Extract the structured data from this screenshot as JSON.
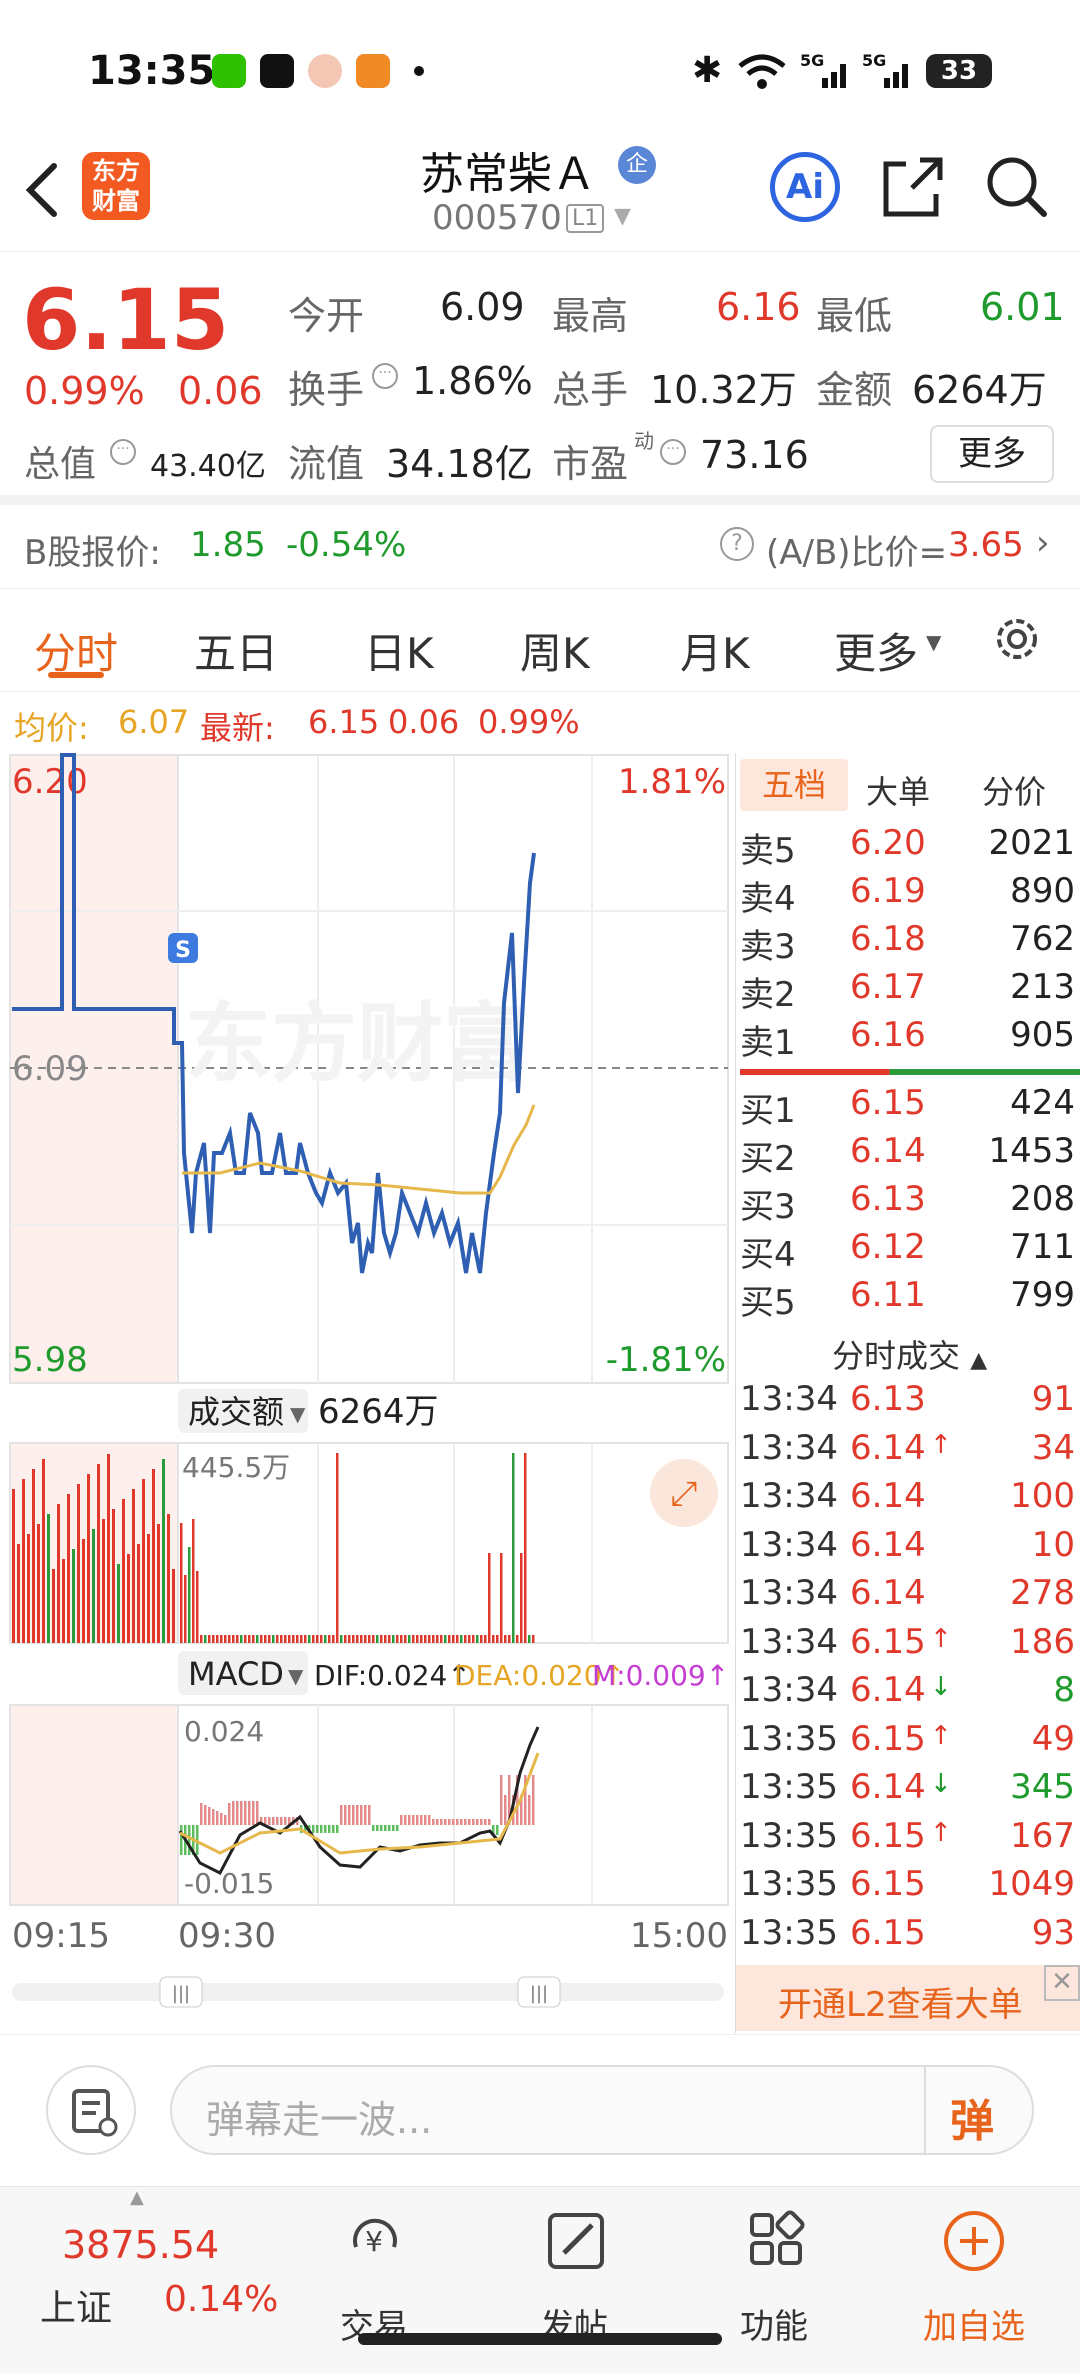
{
  "status_bar": {
    "time": "13:35",
    "battery": "33"
  },
  "header": {
    "stock_name": "苏常柴Ａ",
    "badge": "企",
    "stock_code": "000570",
    "level": "L1",
    "logo_text_line1": "东方",
    "logo_text_line2": "财富",
    "ai_label": "Ai"
  },
  "quote": {
    "price": "6.15",
    "change_pct": "0.99%",
    "change": "0.06",
    "open_label": "今开",
    "open": "6.09",
    "high_label": "最高",
    "high": "6.16",
    "low_label": "最低",
    "low": "6.01",
    "turnover_label": "换手",
    "turnover": "1.86%",
    "volume_label": "总手",
    "volume": "10.32万",
    "amount_label": "金额",
    "amount": "6264万",
    "mcap_label": "总值",
    "mcap": "43.40亿",
    "float_label": "流值",
    "float": "34.18亿",
    "pe_label": "市盈",
    "pe_sup": "动",
    "pe": "73.16",
    "more": "更多"
  },
  "b_share": {
    "label": "B股报价:",
    "price": "1.85",
    "change": "-0.54%",
    "ratio_label": "(A/B)比价=",
    "ratio": "3.65"
  },
  "tabs": [
    "分时",
    "五日",
    "日K",
    "周K",
    "月K",
    "更多"
  ],
  "avg_line": {
    "avg_label": "均价:",
    "avg": "6.07",
    "latest_label": "最新:",
    "latest": "6.15",
    "chg": "0.06",
    "pct": "0.99%"
  },
  "chart": {
    "y_high": "6.20",
    "y_mid": "6.09",
    "y_low": "5.98",
    "pct_high": "1.81%",
    "pct_low": "-1.81%",
    "watermark": "东方财富",
    "marker": "S",
    "vol_selector": "成交额",
    "vol_total": "6264万",
    "vol_max": "445.5万",
    "macd_selector": "MACD",
    "dif": "DIF:0.024↑",
    "dea": "DEA:0.020↑",
    "m": "M:0.009↑",
    "macd_high": "0.024",
    "macd_low": "-0.015",
    "time_start": "09:15",
    "time_open": "09:30",
    "time_end": "15:00",
    "price_series": [
      6.09,
      6.09,
      6.2,
      6.2,
      6.09,
      6.09,
      6.09,
      6.09,
      6.09,
      6.06,
      6.04,
      6.05,
      6.06,
      6.05,
      6.07,
      6.05,
      6.06,
      6.05,
      6.04,
      6.05,
      6.04,
      6.03,
      6.04,
      6.05,
      6.04,
      6.03,
      6.02,
      6.03,
      6.04,
      6.03,
      6.04,
      6.03,
      6.04,
      6.03,
      6.02,
      6.03,
      6.05,
      6.08,
      6.1,
      6.12,
      6.11,
      6.14,
      6.16
    ]
  },
  "order_book": {
    "tabs": [
      "五档",
      "大单",
      "分价"
    ],
    "asks": [
      {
        "label": "卖5",
        "price": "6.20",
        "vol": "2021"
      },
      {
        "label": "卖4",
        "price": "6.19",
        "vol": "890"
      },
      {
        "label": "卖3",
        "price": "6.18",
        "vol": "762"
      },
      {
        "label": "卖2",
        "price": "6.17",
        "vol": "213"
      },
      {
        "label": "卖1",
        "price": "6.16",
        "vol": "905"
      }
    ],
    "bids": [
      {
        "label": "买1",
        "price": "6.15",
        "vol": "424"
      },
      {
        "label": "买2",
        "price": "6.14",
        "vol": "1453"
      },
      {
        "label": "买3",
        "price": "6.13",
        "vol": "208"
      },
      {
        "label": "买4",
        "price": "6.12",
        "vol": "711"
      },
      {
        "label": "买5",
        "price": "6.11",
        "vol": "799"
      }
    ],
    "trades_title": "分时成交",
    "trades": [
      {
        "time": "13:34",
        "price": "6.13",
        "arrow": "",
        "vol": "91",
        "dir": "buy"
      },
      {
        "time": "13:34",
        "price": "6.14",
        "arrow": "↑",
        "vol": "34",
        "dir": "buy"
      },
      {
        "time": "13:34",
        "price": "6.14",
        "arrow": "",
        "vol": "100",
        "dir": "buy"
      },
      {
        "time": "13:34",
        "price": "6.14",
        "arrow": "",
        "vol": "10",
        "dir": "buy"
      },
      {
        "time": "13:34",
        "price": "6.14",
        "arrow": "",
        "vol": "278",
        "dir": "buy"
      },
      {
        "time": "13:34",
        "price": "6.15",
        "arrow": "↑",
        "vol": "186",
        "dir": "buy"
      },
      {
        "time": "13:34",
        "price": "6.14",
        "arrow": "↓",
        "vol": "8",
        "dir": "sell"
      },
      {
        "time": "13:35",
        "price": "6.15",
        "arrow": "↑",
        "vol": "49",
        "dir": "buy"
      },
      {
        "time": "13:35",
        "price": "6.14",
        "arrow": "↓",
        "vol": "345",
        "dir": "sell"
      },
      {
        "time": "13:35",
        "price": "6.15",
        "arrow": "↑",
        "vol": "167",
        "dir": "buy"
      },
      {
        "time": "13:35",
        "price": "6.15",
        "arrow": "",
        "vol": "1049",
        "dir": "buy"
      },
      {
        "time": "13:35",
        "price": "6.15",
        "arrow": "",
        "vol": "93",
        "dir": "buy"
      }
    ],
    "l2_banner": "开通L2查看大单"
  },
  "comment": {
    "placeholder": "弹幕走一波...",
    "danmu": "弹"
  },
  "nav": {
    "index_value": "3875.54",
    "index_name": "上证",
    "index_pct": "0.14%",
    "items": [
      "交易",
      "发帖",
      "功能",
      "加自选"
    ]
  },
  "colors": {
    "up": "#e0392b",
    "down": "#1f9a2c",
    "accent": "#e8641c",
    "line": "#2f5fb3",
    "avg": "#e6b74a"
  }
}
